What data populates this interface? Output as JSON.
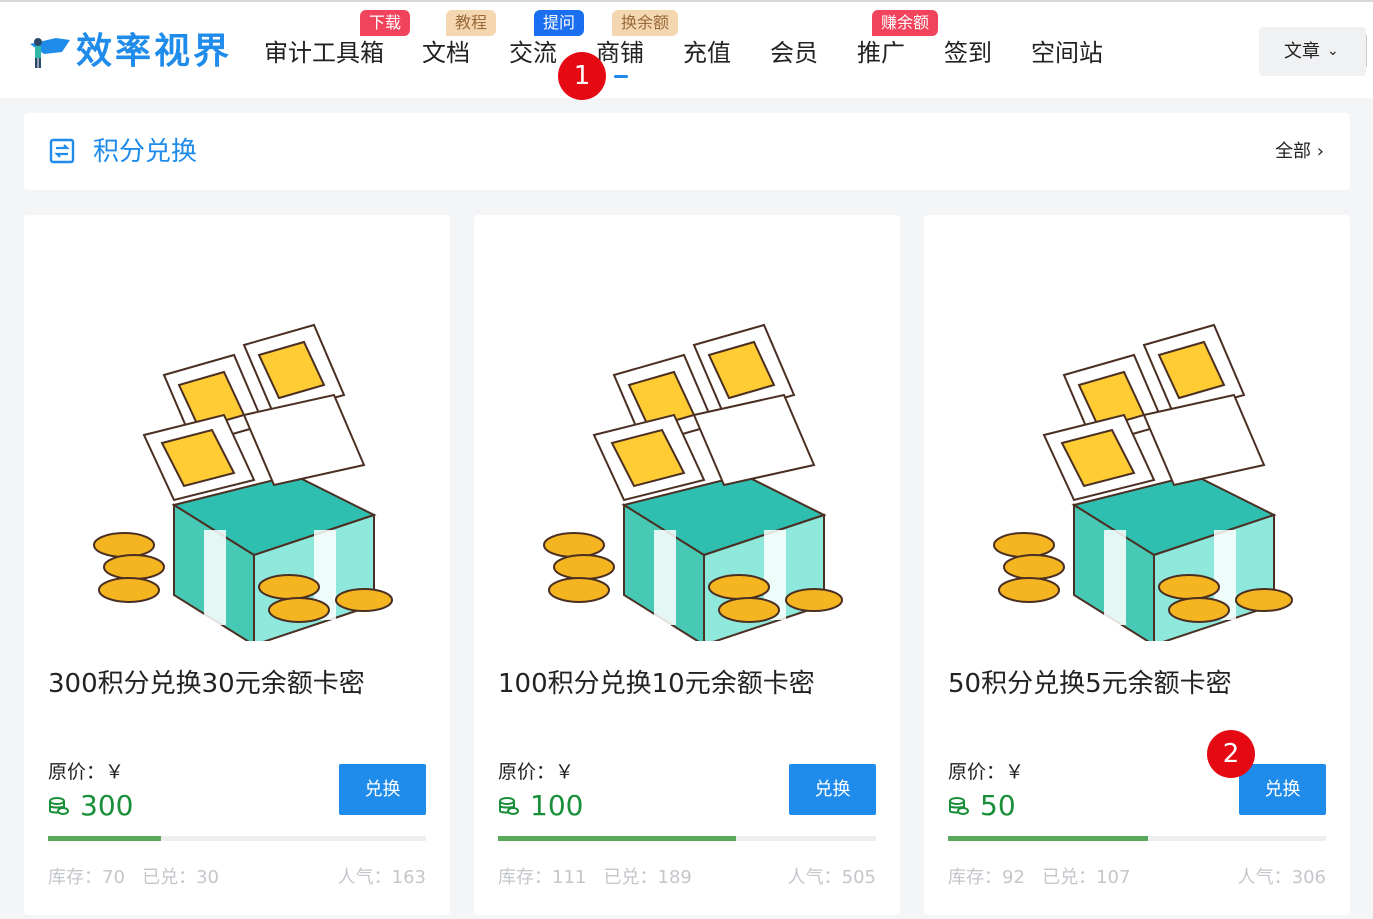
{
  "site": {
    "logo_text": "效率视界",
    "nav": [
      {
        "label": "审计工具箱",
        "badge": "下载",
        "badge_style": "red"
      },
      {
        "label": "文档",
        "badge": "教程",
        "badge_style": "tan"
      },
      {
        "label": "交流",
        "badge": "提问",
        "badge_style": "blue"
      },
      {
        "label": "商铺",
        "badge": "换余额",
        "badge_style": "tan",
        "active": true
      },
      {
        "label": "充值"
      },
      {
        "label": "会员"
      },
      {
        "label": "推广",
        "badge": "赚余额",
        "badge_style": "red"
      },
      {
        "label": "签到"
      },
      {
        "label": "空间站"
      }
    ],
    "dropdown_label": "文章"
  },
  "markers": [
    "1",
    "2"
  ],
  "section": {
    "title": "积分兑换",
    "more_label": "全部"
  },
  "cards": [
    {
      "title": "300积分兑换30元余额卡密",
      "price_label": "原价：￥",
      "price": "300",
      "button": "兑换",
      "progress": 0.3,
      "stock": "库存：70",
      "redeemed": "已兑：30",
      "popularity": "人气：163"
    },
    {
      "title": "100积分兑换10元余额卡密",
      "price_label": "原价：￥",
      "price": "100",
      "button": "兑换",
      "progress": 0.63,
      "stock": "库存：111",
      "redeemed": "已兑：189",
      "popularity": "人气：505"
    },
    {
      "title": "50积分兑换5元余额卡密",
      "price_label": "原价：￥",
      "price": "50",
      "button": "兑换",
      "progress": 0.53,
      "stock": "库存：92",
      "redeemed": "已兑：107",
      "popularity": "人气：306"
    }
  ],
  "colors": {
    "accent": "#1f8ceb",
    "price_green": "#1a8f3a",
    "progress_green": "#5aa95a",
    "badge_red": "#f2435c",
    "badge_tan": "#f4d6b0",
    "badge_blue": "#1a6ef0",
    "marker_red": "#e50914"
  }
}
